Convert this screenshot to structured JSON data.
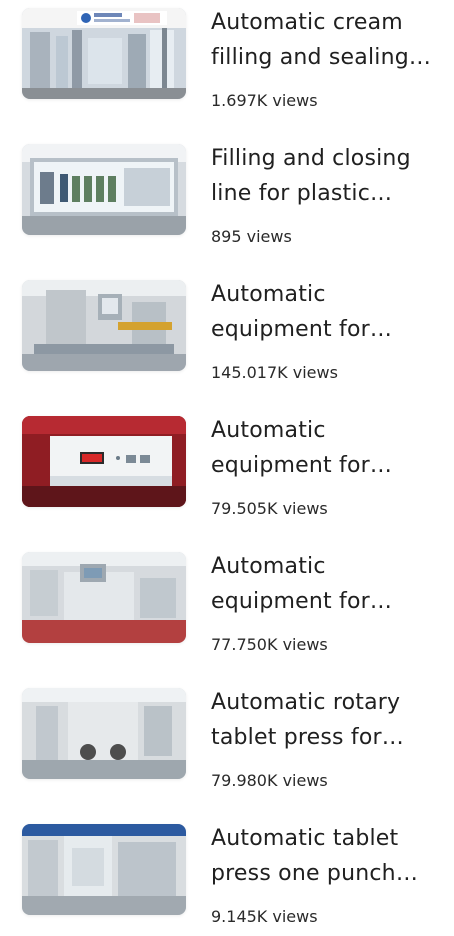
{
  "items": [
    {
      "title": "Automatic cream filling and sealing machine",
      "views": "1.697K",
      "views_suffix": "views"
    },
    {
      "title": "Filling and closing line for plastic bottles",
      "views": "895",
      "views_suffix": "views"
    },
    {
      "title": "Automatic equipment for blister packaging",
      "views": "145.017K",
      "views_suffix": "views"
    },
    {
      "title": "Automatic equipment for blister packaging",
      "views": "79.505K",
      "views_suffix": "views"
    },
    {
      "title": "Automatic equipment for blister packaging",
      "views": "77.750K",
      "views_suffix": "views"
    },
    {
      "title": "Automatic rotary tablet press for pharmaceutical",
      "views": "79.980K",
      "views_suffix": "views"
    },
    {
      "title": "Automatic tablet press one punch machine",
      "views": "9.145K",
      "views_suffix": "views"
    }
  ]
}
